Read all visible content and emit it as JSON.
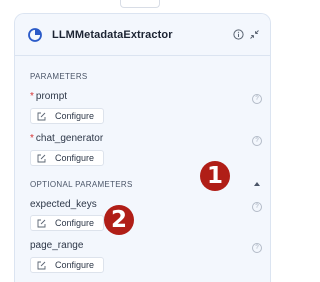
{
  "node": {
    "title": "LLMMetadataExtractor",
    "icon": "component-icon"
  },
  "sections": {
    "parameters": "PARAMETERS",
    "optional": "OPTIONAL PARAMETERS"
  },
  "params": [
    {
      "label": "prompt",
      "required": true,
      "configure": "Configure"
    },
    {
      "label": "chat_generator",
      "required": true,
      "configure": "Configure"
    },
    {
      "label": "expected_keys",
      "required": false,
      "configure": "Configure"
    },
    {
      "label": "page_range",
      "required": false,
      "configure": "Configure"
    }
  ],
  "badges": {
    "one": "1",
    "two": "2"
  },
  "colors": {
    "accent": "#2a5ac8",
    "badge": "#b01e17",
    "panel": "#f3f7fd",
    "required": "#d63232"
  }
}
